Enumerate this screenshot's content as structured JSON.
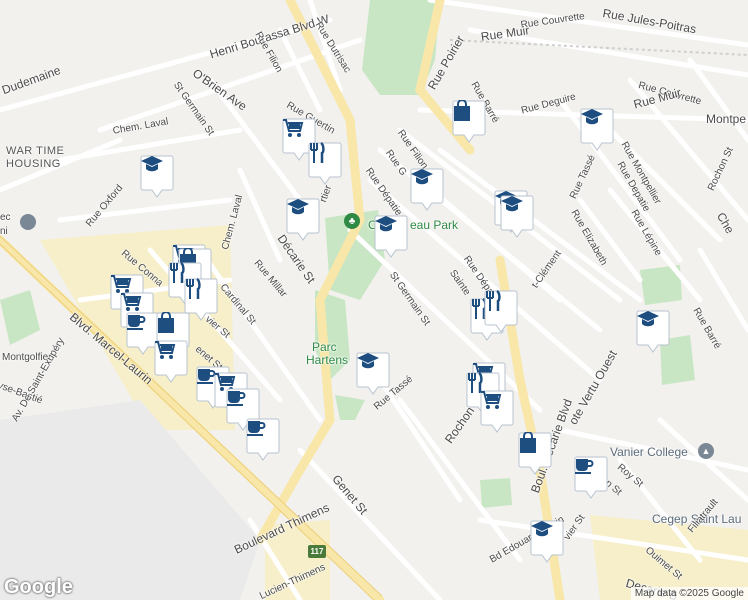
{
  "map": {
    "attribution": "Map data ©2025 Google",
    "logo": "Google",
    "route_shield": "117",
    "labels": {
      "henri_bourassa": "Henri Bourassa Blvd W",
      "jules_poitras": "Rue Jules-Poitras",
      "couvrette_top": "Rue Couvrette",
      "muir_top": "Rue Muir",
      "poirier": "Rue Poirier",
      "filion_top": "Rue Filion",
      "dutrisac": "Rue Dutrisac",
      "obrien": "O'Brien Ave",
      "dudemaine": "Dudemaine",
      "st_germain_w": "St Germain St",
      "chem_laval_w": "Chem. Laval",
      "war_time": "WAR TIME",
      "housing": "HOUSING",
      "guertin": "Rue Guertin",
      "barre_top": "Rue Barré",
      "deguire": "Rue Deguire",
      "couvrette_right": "Rue Couvrette",
      "muir_right": "Rue Muir",
      "montpellier_top": "Montpe",
      "filion_mid": "Rue Filion",
      "rue_g": "Rue G",
      "depatie_mid": "Rue Dépatie",
      "tasse_right": "Rue Tassé",
      "montpellier": "Rue Montpellier",
      "depatie_right": "Rue Depatie",
      "rochon_right": "Rochon St",
      "oxford": "Rue Oxford",
      "cartier_frag": "rtier",
      "chem_laval_v": "Chem. Laval",
      "decarie_st": "Décarie St",
      "park_a": "C",
      "park_b": "eau Park",
      "elizabeth": "Rue Elizabeth",
      "lepine": "Rue Lépine",
      "che_right": "Che",
      "connaught": "Rue Conna",
      "cardinal": "Cardinal St",
      "millar": "Rue Millar",
      "st_germain_mid": "St Germain St",
      "sainte": "Sainte",
      "rue_depa": "Rue Dépa",
      "st_clement": "t-Clément",
      "barre_right": "Rue Barré",
      "vier_st": "vier St",
      "blvd_marcel": "Blvd. Marcel-Laurin",
      "montgolfier": "Montgolfier",
      "ysse_bastie": "yse-Bastié",
      "saint_exupery": "Av. De Saint-Exupéry",
      "genet_w": "enet St",
      "parc_a": "Parc",
      "parc_b": "Hartens",
      "rue_tasse": "Rue Tassé",
      "rochon_st": "Rochon St",
      "cote_vertu": "ote Vertu Ouest",
      "vanier_college": "Vanier College",
      "boul_decarie": "Boul. Decarie Blvd",
      "roy_st": "Roy St",
      "n_st": "n St",
      "cegep": "Cegep Saint Lau",
      "filiatrault": "Filiatrault",
      "genet_s": "Genet St",
      "boulevard_thimens": "Boulevard Thimens",
      "lucien_thimens": "Lucien-Thimens",
      "bd_edouard": "Bd Edouard-Laurin",
      "vier_s": "vier St",
      "ouimet": "Ouimet St",
      "decarie_br": "Decarie B",
      "ec_a": "ec",
      "ec_b": "ni"
    },
    "icons": {
      "cafe": "coffee-cup-icon",
      "grocery": "shopping-cart-icon",
      "restaurant": "fork-knife-icon",
      "school": "graduation-cap-icon",
      "store": "shopping-bag-icon",
      "park": "tree-icon",
      "university": "university-icon"
    },
    "colors": {
      "pin_bg": "#ffffff",
      "pin_icon": "#1e4e80",
      "park_green": "#c8e6c3",
      "road_yellow": "#f8e7a8"
    },
    "markers": [
      {
        "type": "school"
      },
      {
        "type": "grocery"
      },
      {
        "type": "restaurant"
      },
      {
        "type": "store"
      },
      {
        "type": "school"
      },
      {
        "type": "school"
      },
      {
        "type": "school"
      },
      {
        "type": "school"
      },
      {
        "type": "school"
      },
      {
        "type": "school"
      },
      {
        "type": "grocery"
      },
      {
        "type": "store"
      },
      {
        "type": "restaurant"
      },
      {
        "type": "restaurant"
      },
      {
        "type": "grocery"
      },
      {
        "type": "grocery"
      },
      {
        "type": "cafe"
      },
      {
        "type": "store"
      },
      {
        "type": "grocery"
      },
      {
        "type": "cafe"
      },
      {
        "type": "grocery"
      },
      {
        "type": "cafe"
      },
      {
        "type": "cafe"
      },
      {
        "type": "restaurant"
      },
      {
        "type": "restaurant"
      },
      {
        "type": "school"
      },
      {
        "type": "school"
      },
      {
        "type": "grocery"
      },
      {
        "type": "restaurant"
      },
      {
        "type": "grocery"
      },
      {
        "type": "store"
      },
      {
        "type": "cafe"
      },
      {
        "type": "school"
      }
    ]
  }
}
